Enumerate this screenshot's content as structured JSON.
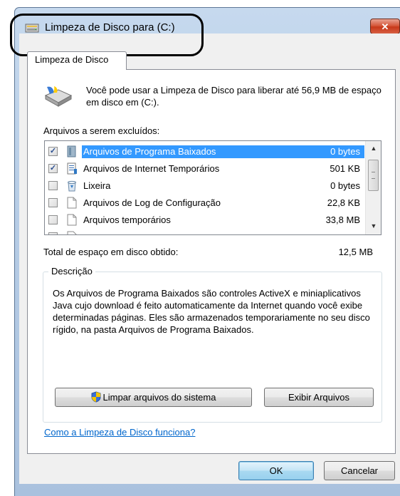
{
  "window": {
    "title": "Limpeza de Disco para  (C:)",
    "close_symbol": "✕"
  },
  "tab": {
    "label": "Limpeza de Disco"
  },
  "intro": {
    "text": "Você pode usar a Limpeza de Disco para liberar até 56,9 MB de espaço em disco em  (C:)."
  },
  "files": {
    "label": "Arquivos a serem excluídos:",
    "items": [
      {
        "checked": true,
        "icon": "downloaded-program-folder-icon",
        "name": "Arquivos de Programa Baixados",
        "size": "0 bytes",
        "selected": true
      },
      {
        "checked": true,
        "icon": "internet-files-icon",
        "name": "Arquivos de Internet Temporários",
        "size": "501 KB",
        "selected": false
      },
      {
        "checked": false,
        "icon": "recycle-bin-icon",
        "name": "Lixeira",
        "size": "0 bytes",
        "selected": false
      },
      {
        "checked": false,
        "icon": "document-icon",
        "name": "Arquivos de Log de Configuração",
        "size": "22,8 KB",
        "selected": false
      },
      {
        "checked": false,
        "icon": "document-icon",
        "name": "Arquivos temporários",
        "size": "33,8 MB",
        "selected": false
      }
    ]
  },
  "total": {
    "label": "Total de espaço em disco obtido:",
    "value": "12,5 MB"
  },
  "description": {
    "title": "Descrição",
    "text": "Os Arquivos de Programa Baixados são controles ActiveX e miniaplicativos Java cujo download é feito automaticamente da Internet quando você exibe determinadas páginas. Eles são armazenados temporariamente no seu disco rígido, na pasta Arquivos de Programa Baixados."
  },
  "buttons": {
    "clean_system": "Limpar arquivos do sistema",
    "view_files": "Exibir Arquivos",
    "ok": "OK",
    "cancel": "Cancelar"
  },
  "help_link": "Como a Limpeza de Disco funciona?"
}
